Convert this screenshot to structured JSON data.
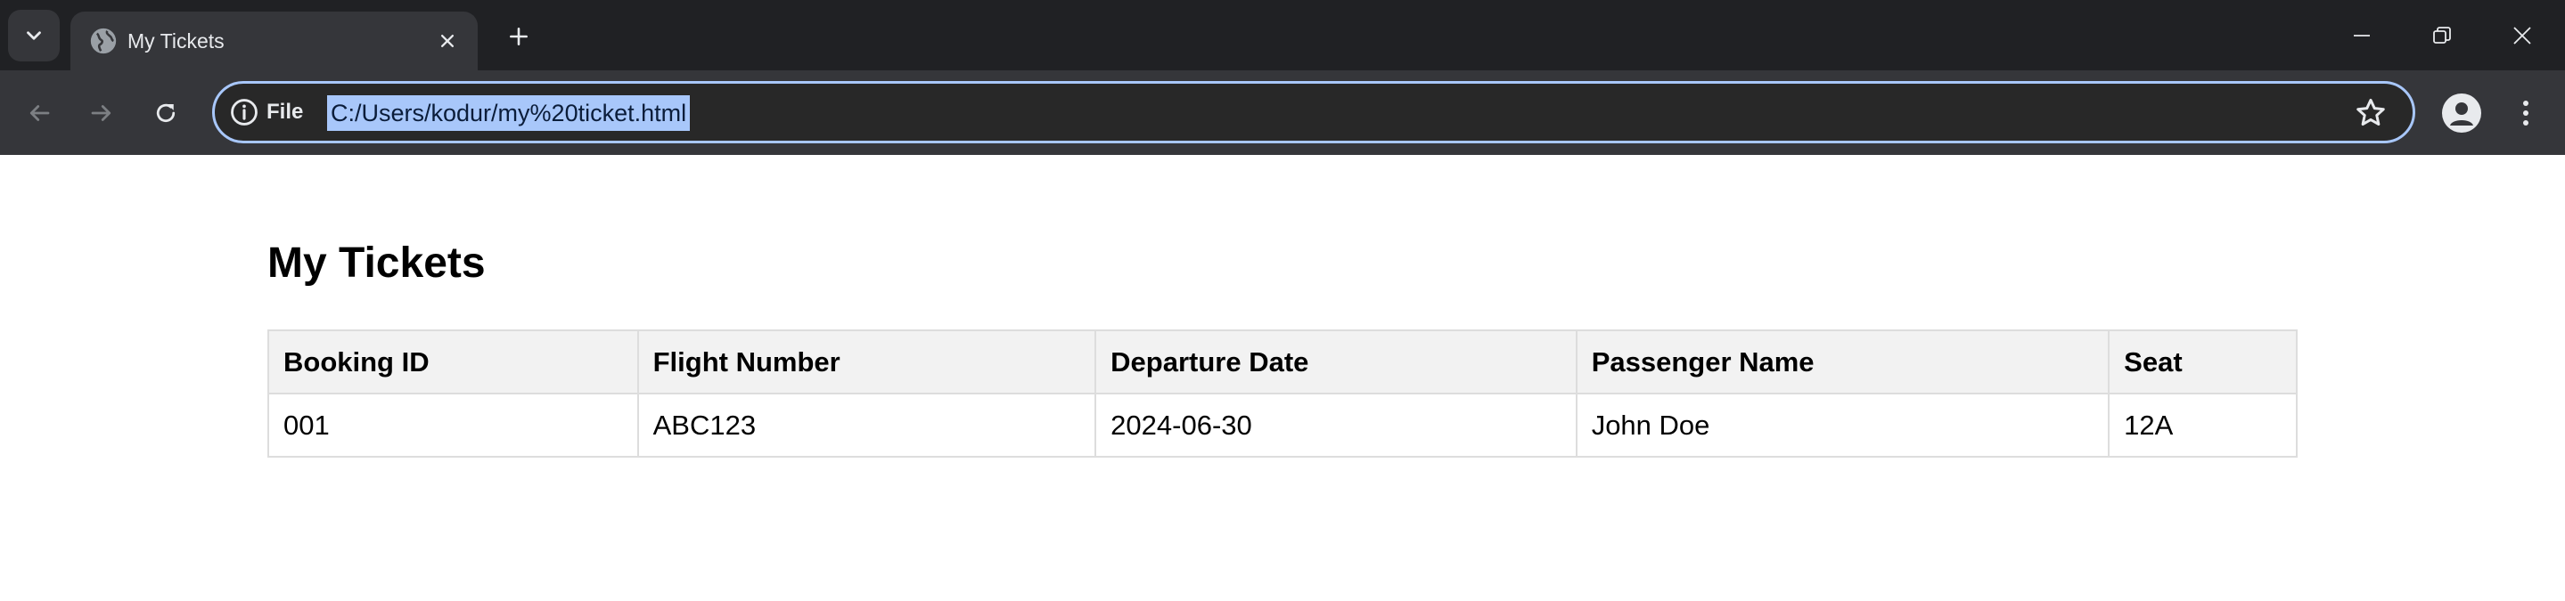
{
  "browser": {
    "tab": {
      "title": "My Tickets"
    },
    "omnibox": {
      "scheme_label": "File",
      "url": "C:/Users/kodur/my%20ticket.html"
    },
    "icons": {
      "tab_search": "chevron-down-icon",
      "favicon": "globe-icon",
      "tab_close": "close-icon",
      "new_tab": "plus-icon",
      "minimize": "minimize-icon",
      "restore": "restore-icon",
      "window_close": "close-icon",
      "back": "arrow-left-icon",
      "forward": "arrow-right-icon",
      "reload": "reload-icon",
      "site_info": "info-icon",
      "bookmark": "star-icon",
      "profile": "profile-icon",
      "menu": "more-vertical-icon"
    },
    "colors": {
      "tabstrip_bg": "#202124",
      "toolbar_bg": "#35363a",
      "omnibox_border": "#a8c7fa",
      "url_selection": "#a8c7fa"
    }
  },
  "page": {
    "heading": "My Tickets",
    "table": {
      "headers": [
        "Booking ID",
        "Flight Number",
        "Departure Date",
        "Passenger Name",
        "Seat"
      ],
      "rows": [
        [
          "001",
          "ABC123",
          "2024-06-30",
          "John Doe",
          "12A"
        ]
      ]
    },
    "colors": {
      "header_bg": "#f2f2f2",
      "border": "#dddddd"
    }
  }
}
